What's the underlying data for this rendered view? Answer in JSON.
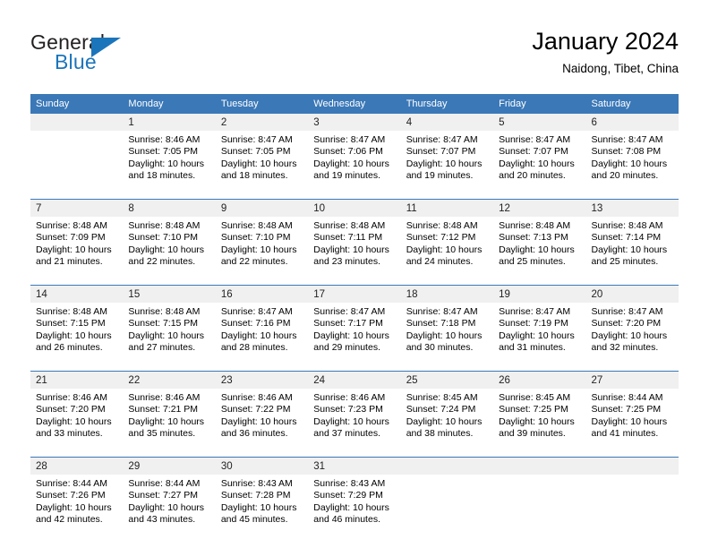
{
  "branding": {
    "logo_text_top": "General",
    "logo_text_bottom": "Blue",
    "logo_color": "#1b75bb",
    "logo_text_color": "#231f20"
  },
  "header": {
    "title": "January 2024",
    "subtitle": "Naidong, Tibet, China"
  },
  "theme": {
    "header_bg": "#3b78b7",
    "header_text": "#ffffff",
    "daynum_bg": "#f0f0f0",
    "row_divider": "#3b78b7",
    "page_bg": "#ffffff"
  },
  "calendar": {
    "weekday_headers": [
      "Sunday",
      "Monday",
      "Tuesday",
      "Wednesday",
      "Thursday",
      "Friday",
      "Saturday"
    ],
    "weeks": [
      [
        {
          "day": "",
          "lines": []
        },
        {
          "day": "1",
          "lines": [
            "Sunrise: 8:46 AM",
            "Sunset: 7:05 PM",
            "Daylight: 10 hours",
            "and 18 minutes."
          ]
        },
        {
          "day": "2",
          "lines": [
            "Sunrise: 8:47 AM",
            "Sunset: 7:05 PM",
            "Daylight: 10 hours",
            "and 18 minutes."
          ]
        },
        {
          "day": "3",
          "lines": [
            "Sunrise: 8:47 AM",
            "Sunset: 7:06 PM",
            "Daylight: 10 hours",
            "and 19 minutes."
          ]
        },
        {
          "day": "4",
          "lines": [
            "Sunrise: 8:47 AM",
            "Sunset: 7:07 PM",
            "Daylight: 10 hours",
            "and 19 minutes."
          ]
        },
        {
          "day": "5",
          "lines": [
            "Sunrise: 8:47 AM",
            "Sunset: 7:07 PM",
            "Daylight: 10 hours",
            "and 20 minutes."
          ]
        },
        {
          "day": "6",
          "lines": [
            "Sunrise: 8:47 AM",
            "Sunset: 7:08 PM",
            "Daylight: 10 hours",
            "and 20 minutes."
          ]
        }
      ],
      [
        {
          "day": "7",
          "lines": [
            "Sunrise: 8:48 AM",
            "Sunset: 7:09 PM",
            "Daylight: 10 hours",
            "and 21 minutes."
          ]
        },
        {
          "day": "8",
          "lines": [
            "Sunrise: 8:48 AM",
            "Sunset: 7:10 PM",
            "Daylight: 10 hours",
            "and 22 minutes."
          ]
        },
        {
          "day": "9",
          "lines": [
            "Sunrise: 8:48 AM",
            "Sunset: 7:10 PM",
            "Daylight: 10 hours",
            "and 22 minutes."
          ]
        },
        {
          "day": "10",
          "lines": [
            "Sunrise: 8:48 AM",
            "Sunset: 7:11 PM",
            "Daylight: 10 hours",
            "and 23 minutes."
          ]
        },
        {
          "day": "11",
          "lines": [
            "Sunrise: 8:48 AM",
            "Sunset: 7:12 PM",
            "Daylight: 10 hours",
            "and 24 minutes."
          ]
        },
        {
          "day": "12",
          "lines": [
            "Sunrise: 8:48 AM",
            "Sunset: 7:13 PM",
            "Daylight: 10 hours",
            "and 25 minutes."
          ]
        },
        {
          "day": "13",
          "lines": [
            "Sunrise: 8:48 AM",
            "Sunset: 7:14 PM",
            "Daylight: 10 hours",
            "and 25 minutes."
          ]
        }
      ],
      [
        {
          "day": "14",
          "lines": [
            "Sunrise: 8:48 AM",
            "Sunset: 7:15 PM",
            "Daylight: 10 hours",
            "and 26 minutes."
          ]
        },
        {
          "day": "15",
          "lines": [
            "Sunrise: 8:48 AM",
            "Sunset: 7:15 PM",
            "Daylight: 10 hours",
            "and 27 minutes."
          ]
        },
        {
          "day": "16",
          "lines": [
            "Sunrise: 8:47 AM",
            "Sunset: 7:16 PM",
            "Daylight: 10 hours",
            "and 28 minutes."
          ]
        },
        {
          "day": "17",
          "lines": [
            "Sunrise: 8:47 AM",
            "Sunset: 7:17 PM",
            "Daylight: 10 hours",
            "and 29 minutes."
          ]
        },
        {
          "day": "18",
          "lines": [
            "Sunrise: 8:47 AM",
            "Sunset: 7:18 PM",
            "Daylight: 10 hours",
            "and 30 minutes."
          ]
        },
        {
          "day": "19",
          "lines": [
            "Sunrise: 8:47 AM",
            "Sunset: 7:19 PM",
            "Daylight: 10 hours",
            "and 31 minutes."
          ]
        },
        {
          "day": "20",
          "lines": [
            "Sunrise: 8:47 AM",
            "Sunset: 7:20 PM",
            "Daylight: 10 hours",
            "and 32 minutes."
          ]
        }
      ],
      [
        {
          "day": "21",
          "lines": [
            "Sunrise: 8:46 AM",
            "Sunset: 7:20 PM",
            "Daylight: 10 hours",
            "and 33 minutes."
          ]
        },
        {
          "day": "22",
          "lines": [
            "Sunrise: 8:46 AM",
            "Sunset: 7:21 PM",
            "Daylight: 10 hours",
            "and 35 minutes."
          ]
        },
        {
          "day": "23",
          "lines": [
            "Sunrise: 8:46 AM",
            "Sunset: 7:22 PM",
            "Daylight: 10 hours",
            "and 36 minutes."
          ]
        },
        {
          "day": "24",
          "lines": [
            "Sunrise: 8:46 AM",
            "Sunset: 7:23 PM",
            "Daylight: 10 hours",
            "and 37 minutes."
          ]
        },
        {
          "day": "25",
          "lines": [
            "Sunrise: 8:45 AM",
            "Sunset: 7:24 PM",
            "Daylight: 10 hours",
            "and 38 minutes."
          ]
        },
        {
          "day": "26",
          "lines": [
            "Sunrise: 8:45 AM",
            "Sunset: 7:25 PM",
            "Daylight: 10 hours",
            "and 39 minutes."
          ]
        },
        {
          "day": "27",
          "lines": [
            "Sunrise: 8:44 AM",
            "Sunset: 7:25 PM",
            "Daylight: 10 hours",
            "and 41 minutes."
          ]
        }
      ],
      [
        {
          "day": "28",
          "lines": [
            "Sunrise: 8:44 AM",
            "Sunset: 7:26 PM",
            "Daylight: 10 hours",
            "and 42 minutes."
          ]
        },
        {
          "day": "29",
          "lines": [
            "Sunrise: 8:44 AM",
            "Sunset: 7:27 PM",
            "Daylight: 10 hours",
            "and 43 minutes."
          ]
        },
        {
          "day": "30",
          "lines": [
            "Sunrise: 8:43 AM",
            "Sunset: 7:28 PM",
            "Daylight: 10 hours",
            "and 45 minutes."
          ]
        },
        {
          "day": "31",
          "lines": [
            "Sunrise: 8:43 AM",
            "Sunset: 7:29 PM",
            "Daylight: 10 hours",
            "and 46 minutes."
          ]
        },
        {
          "day": "",
          "lines": []
        },
        {
          "day": "",
          "lines": []
        },
        {
          "day": "",
          "lines": []
        }
      ]
    ]
  }
}
